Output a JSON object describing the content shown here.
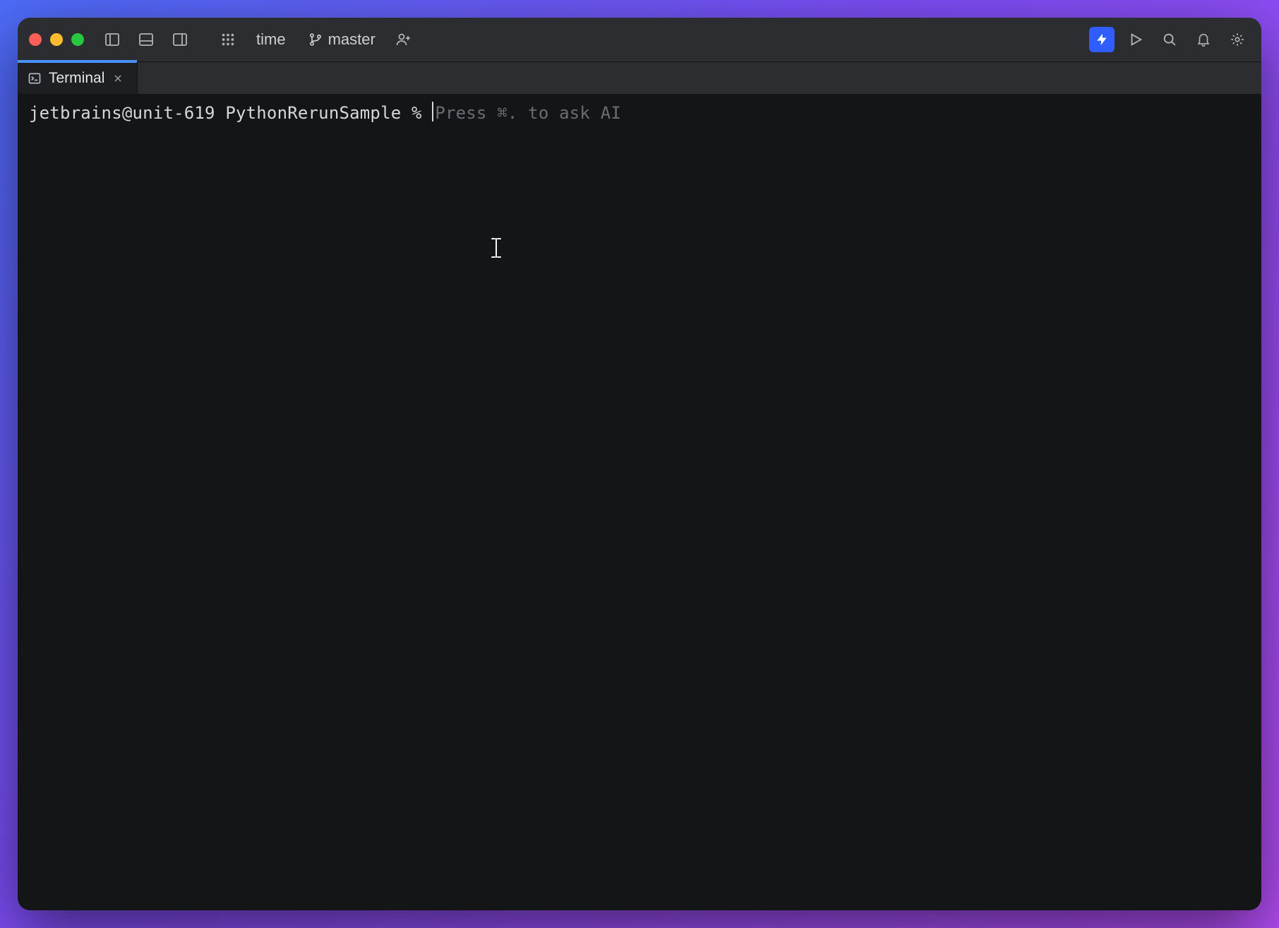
{
  "titlebar": {
    "project_label": "time",
    "branch_label": "master"
  },
  "tab": {
    "label": "Terminal"
  },
  "terminal": {
    "prompt": "jetbrains@unit-619 PythonRerunSample % ",
    "ghost_hint": "Press ⌘. to ask AI"
  }
}
